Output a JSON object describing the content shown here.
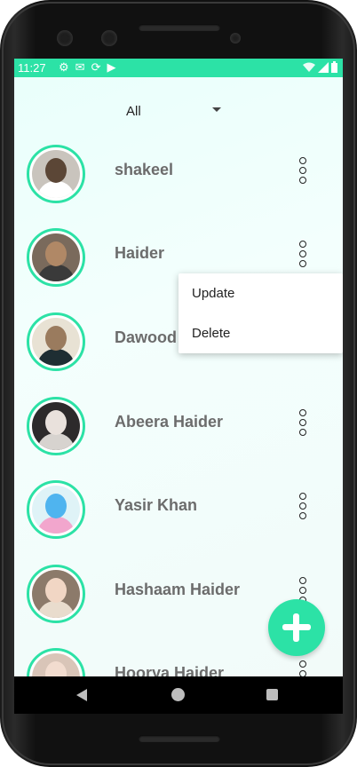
{
  "status_bar": {
    "time": "11:27",
    "left_icons": [
      "gear-icon",
      "gmail-icon",
      "sync-icon",
      "play-store-icon"
    ],
    "right_icons": [
      "wifi-icon",
      "signal-icon",
      "battery-icon"
    ]
  },
  "filter": {
    "selected": "All"
  },
  "contacts": [
    {
      "name": "shakeel",
      "avatar_colors": [
        "#c9c4bd",
        "#5b4636",
        "#ffffff"
      ]
    },
    {
      "name": "Haider",
      "avatar_colors": [
        "#7a6a5c",
        "#b08866",
        "#3a3a3a"
      ]
    },
    {
      "name": "Dawood",
      "avatar_colors": [
        "#e8e2d4",
        "#9a7b5e",
        "#1e2e33"
      ]
    },
    {
      "name": "Abeera Haider",
      "avatar_colors": [
        "#2d2a2b",
        "#e9e1dc",
        "#d7d3cf"
      ]
    },
    {
      "name": "Yasir Khan",
      "avatar_colors": [
        "#dff3f7",
        "#4fb4ef",
        "#f2a6cd"
      ]
    },
    {
      "name": "Hashaam Haider",
      "avatar_colors": [
        "#8c7a6a",
        "#f1d6c4",
        "#e9dccd"
      ]
    },
    {
      "name": "Hoorya Haider",
      "avatar_colors": [
        "#d9c5b8",
        "#f2dccf",
        "#b79d8c"
      ]
    }
  ],
  "popup_menu": {
    "items": [
      "Update",
      "Delete"
    ]
  },
  "colors": {
    "accent": "#2ce2a6",
    "name_text": "#6c6c6c"
  }
}
